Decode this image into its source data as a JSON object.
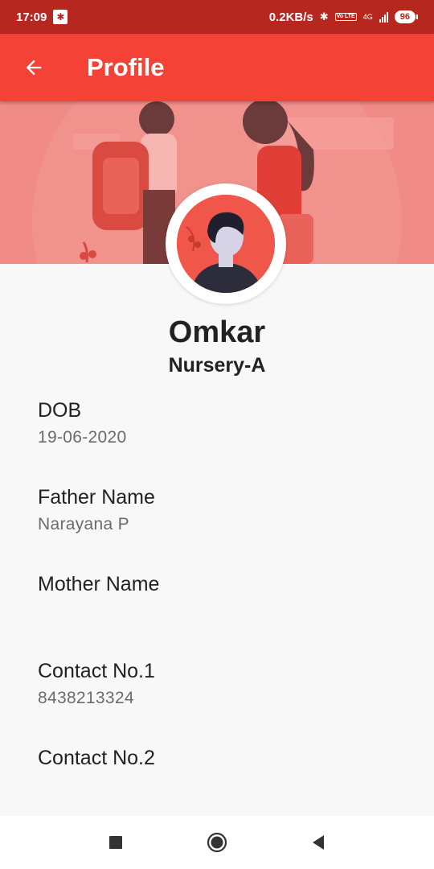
{
  "status_bar": {
    "time": "17:09",
    "network_speed": "0.2KB/s",
    "network_type": "4G",
    "volte_label": "Vo LTE",
    "battery": "96",
    "icons": [
      "bluetooth-icon",
      "volte-icon",
      "signal-icon",
      "battery-icon"
    ]
  },
  "app_bar": {
    "title": "Profile",
    "back_icon": "arrow-back-icon",
    "color": "#f44336"
  },
  "profile": {
    "name": "Omkar",
    "class": "Nursery-A"
  },
  "fields": [
    {
      "label": "DOB",
      "value": "19-06-2020"
    },
    {
      "label": "Father Name",
      "value": "Narayana P"
    },
    {
      "label": "Mother Name",
      "value": ""
    },
    {
      "label": "Contact No.1",
      "value": "8438213324"
    },
    {
      "label": "Contact No.2",
      "value": ""
    }
  ],
  "nav_bar": {
    "icons": [
      "recents-square-icon",
      "home-circle-icon",
      "back-triangle-icon"
    ]
  },
  "colors": {
    "status_bar": "#b6271f",
    "app_bar": "#f44336",
    "banner": "#f28b87",
    "background": "#f8f8f8"
  }
}
